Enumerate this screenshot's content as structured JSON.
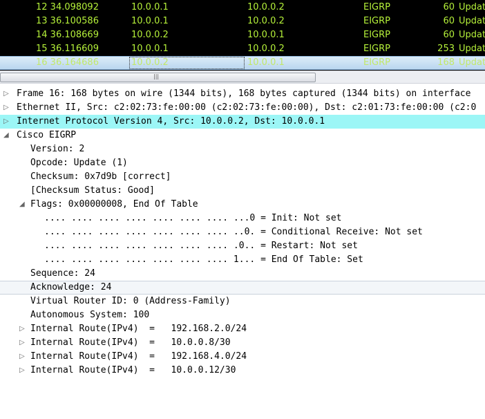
{
  "packet_list": {
    "rows": [
      {
        "no_time": "12 34.098092",
        "src": "10.0.0.1",
        "dst": "10.0.0.2",
        "proto": "EIGRP",
        "len": "60",
        "info": "Update"
      },
      {
        "no_time": "13 36.100586",
        "src": "10.0.0.1",
        "dst": "10.0.0.2",
        "proto": "EIGRP",
        "len": "60",
        "info": "Update"
      },
      {
        "no_time": "14 36.108669",
        "src": "10.0.0.2",
        "dst": "10.0.0.1",
        "proto": "EIGRP",
        "len": "60",
        "info": "Update"
      },
      {
        "no_time": "15 36.116609",
        "src": "10.0.0.1",
        "dst": "10.0.0.2",
        "proto": "EIGRP",
        "len": "253",
        "info": "Update"
      },
      {
        "no_time": "16 36.164686",
        "src": "10.0.0.2",
        "dst": "10.0.0.1",
        "proto": "EIGRP",
        "len": "168",
        "info": "Update"
      }
    ],
    "scroll_grip": "|||"
  },
  "details": {
    "frame": "Frame 16: 168 bytes on wire (1344 bits), 168 bytes captured (1344 bits) on interface",
    "ethernet": "Ethernet II, Src: c2:02:73:fe:00:00 (c2:02:73:fe:00:00), Dst: c2:01:73:fe:00:00 (c2:0",
    "ip": "Internet Protocol Version 4, Src: 10.0.0.2, Dst: 10.0.0.1",
    "eigrp": "Cisco EIGRP",
    "version": "Version: 2",
    "opcode": "Opcode: Update (1)",
    "checksum": "Checksum: 0x7d9b [correct]",
    "checksum_status": "[Checksum Status: Good]",
    "flags": "Flags: 0x00000008, End Of Table",
    "flag_init": ".... .... .... .... .... .... .... ...0 = Init: Not set",
    "flag_cr": ".... .... .... .... .... .... .... ..0. = Conditional Receive: Not set",
    "flag_restart": ".... .... .... .... .... .... .... .0.. = Restart: Not set",
    "flag_eot": ".... .... .... .... .... .... .... 1... = End Of Table: Set",
    "sequence": "Sequence: 24",
    "acknowledge": "Acknowledge: 24",
    "vrid": "Virtual Router ID: 0 (Address-Family)",
    "as": "Autonomous System: 100",
    "route1": "Internal Route(IPv4)  =   192.168.2.0/24",
    "route2": "Internal Route(IPv4)  =   10.0.0.8/30",
    "route3": "Internal Route(IPv4)  =   192.168.4.0/24",
    "route4": "Internal Route(IPv4)  =   10.0.0.12/30"
  },
  "icons": {
    "collapsed": "triangle-right-icon",
    "expanded": "triangle-down-icon"
  },
  "colors": {
    "list_bg": "#000000",
    "list_fg": "#b6f23a",
    "ip_highlight": "#9cf6f6"
  }
}
